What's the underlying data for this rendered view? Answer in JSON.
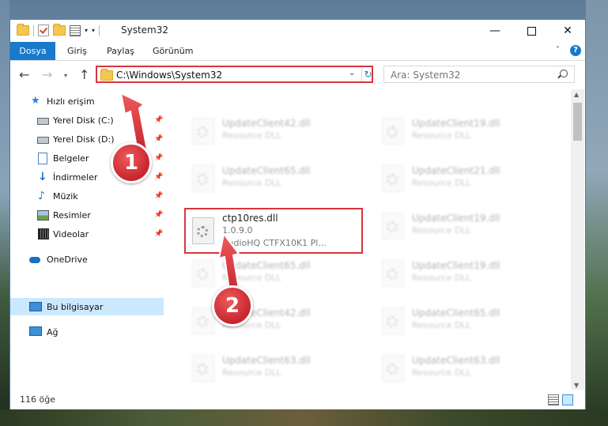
{
  "window": {
    "title": "System32",
    "minimize_label": "—",
    "maximize_label": "",
    "close_label": "✕"
  },
  "ribbon": {
    "tabs": [
      "Dosya",
      "Giriş",
      "Paylaş",
      "Görünüm"
    ],
    "help_label": "?"
  },
  "nav": {
    "address": "C:\\Windows\\System32",
    "search_placeholder": "Ara: System32"
  },
  "sidebar": {
    "items": [
      {
        "label": "Hızlı erişim",
        "icon": "star-icon"
      },
      {
        "label": "Yerel Disk (C:)",
        "icon": "drive-icon",
        "pinned": true
      },
      {
        "label": "Yerel Disk (D:)",
        "icon": "drive-icon",
        "pinned": true
      },
      {
        "label": "Belgeler",
        "icon": "documents-icon",
        "pinned": true
      },
      {
        "label": "İndirmeler",
        "icon": "downloads-icon",
        "pinned": true
      },
      {
        "label": "Müzik",
        "icon": "music-icon",
        "pinned": true
      },
      {
        "label": "Resimler",
        "icon": "pictures-icon",
        "pinned": true
      },
      {
        "label": "Videolar",
        "icon": "videos-icon",
        "pinned": true
      },
      {
        "label": "OneDrive",
        "icon": "onedrive-icon"
      },
      {
        "label": "Bu bilgisayar",
        "icon": "this-pc-icon",
        "selected": true
      },
      {
        "label": "Ağ",
        "icon": "network-icon"
      }
    ]
  },
  "files": {
    "blurred": [
      {
        "name": "UpdateClient42.dll",
        "desc": "Resource DLL"
      },
      {
        "name": "UpdateClient19.dll",
        "desc": "Resource DLL"
      },
      {
        "name": "UpdateClient65.dll",
        "desc": "Resource DLL"
      },
      {
        "name": "UpdateClient21.dll",
        "desc": "Resource DLL"
      },
      {
        "name": "UpdateClient19.dll",
        "desc": "Resource DLL"
      },
      {
        "name": "UpdateClient65.dll",
        "desc": "Resource DLL"
      },
      {
        "name": "UpdateClient19.dll",
        "desc": "Resource DLL"
      },
      {
        "name": "UpdateClient42.dll",
        "desc": "Resource DLL"
      },
      {
        "name": "UpdateClient65.dll",
        "desc": "Resource DLL"
      },
      {
        "name": "UpdateClient63.dll",
        "desc": "Resource DLL"
      },
      {
        "name": "UpdateClient63.dll",
        "desc": "Resource DLL"
      }
    ],
    "selected": {
      "name": "ctp10res.dll",
      "version": "1.0.9.0",
      "company": "AudioHQ CTFX10K1 Pl..."
    }
  },
  "callouts": {
    "one": "1",
    "two": "2"
  },
  "status": {
    "count": "116 öğe"
  },
  "colors": {
    "accent": "#1979ca",
    "highlight": "#d9343f",
    "selection": "#cce8ff"
  }
}
